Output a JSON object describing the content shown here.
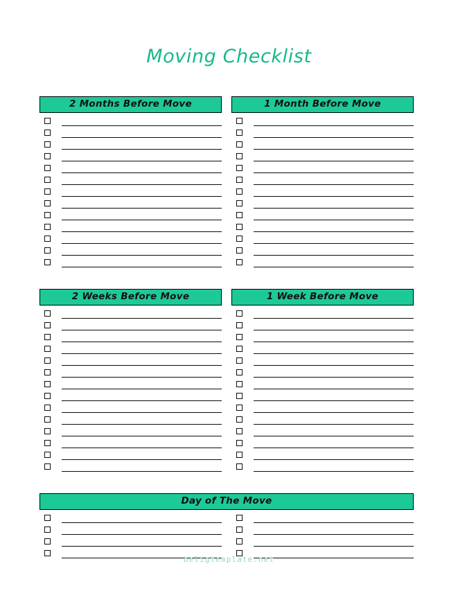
{
  "document": {
    "title": "Moving Checklist",
    "title_color": "#16b98c",
    "accent_color": "#1ec998",
    "border_color": "#000000",
    "page_background": "#ffffff",
    "footer": "beligtemplate.net",
    "footer_color": "#8fd8c8"
  },
  "sections": [
    {
      "id": "two-months-before-move",
      "heading": "2 Months Before Move",
      "column": "left",
      "row": 1,
      "item_count": 13,
      "items": [
        "",
        "",
        "",
        "",
        "",
        "",
        "",
        "",
        "",
        "",
        "",
        "",
        ""
      ]
    },
    {
      "id": "one-month-before-move",
      "heading": "1 Month Before Move",
      "column": "right",
      "row": 1,
      "item_count": 13,
      "items": [
        "",
        "",
        "",
        "",
        "",
        "",
        "",
        "",
        "",
        "",
        "",
        "",
        ""
      ]
    },
    {
      "id": "two-weeks-before-move",
      "heading": "2 Weeks Before Move",
      "column": "left",
      "row": 2,
      "item_count": 14,
      "items": [
        "",
        "",
        "",
        "",
        "",
        "",
        "",
        "",
        "",
        "",
        "",
        "",
        "",
        ""
      ]
    },
    {
      "id": "one-week-before-move",
      "heading": "1 Week Before Move",
      "column": "right",
      "row": 2,
      "item_count": 14,
      "items": [
        "",
        "",
        "",
        "",
        "",
        "",
        "",
        "",
        "",
        "",
        "",
        "",
        "",
        ""
      ]
    },
    {
      "id": "day-of-the-move",
      "heading": "Day of The Move",
      "column": "full",
      "row": 3,
      "item_count": 8,
      "columns": 2,
      "items_left": [
        "",
        "",
        "",
        ""
      ],
      "items_right": [
        "",
        "",
        "",
        ""
      ]
    }
  ]
}
